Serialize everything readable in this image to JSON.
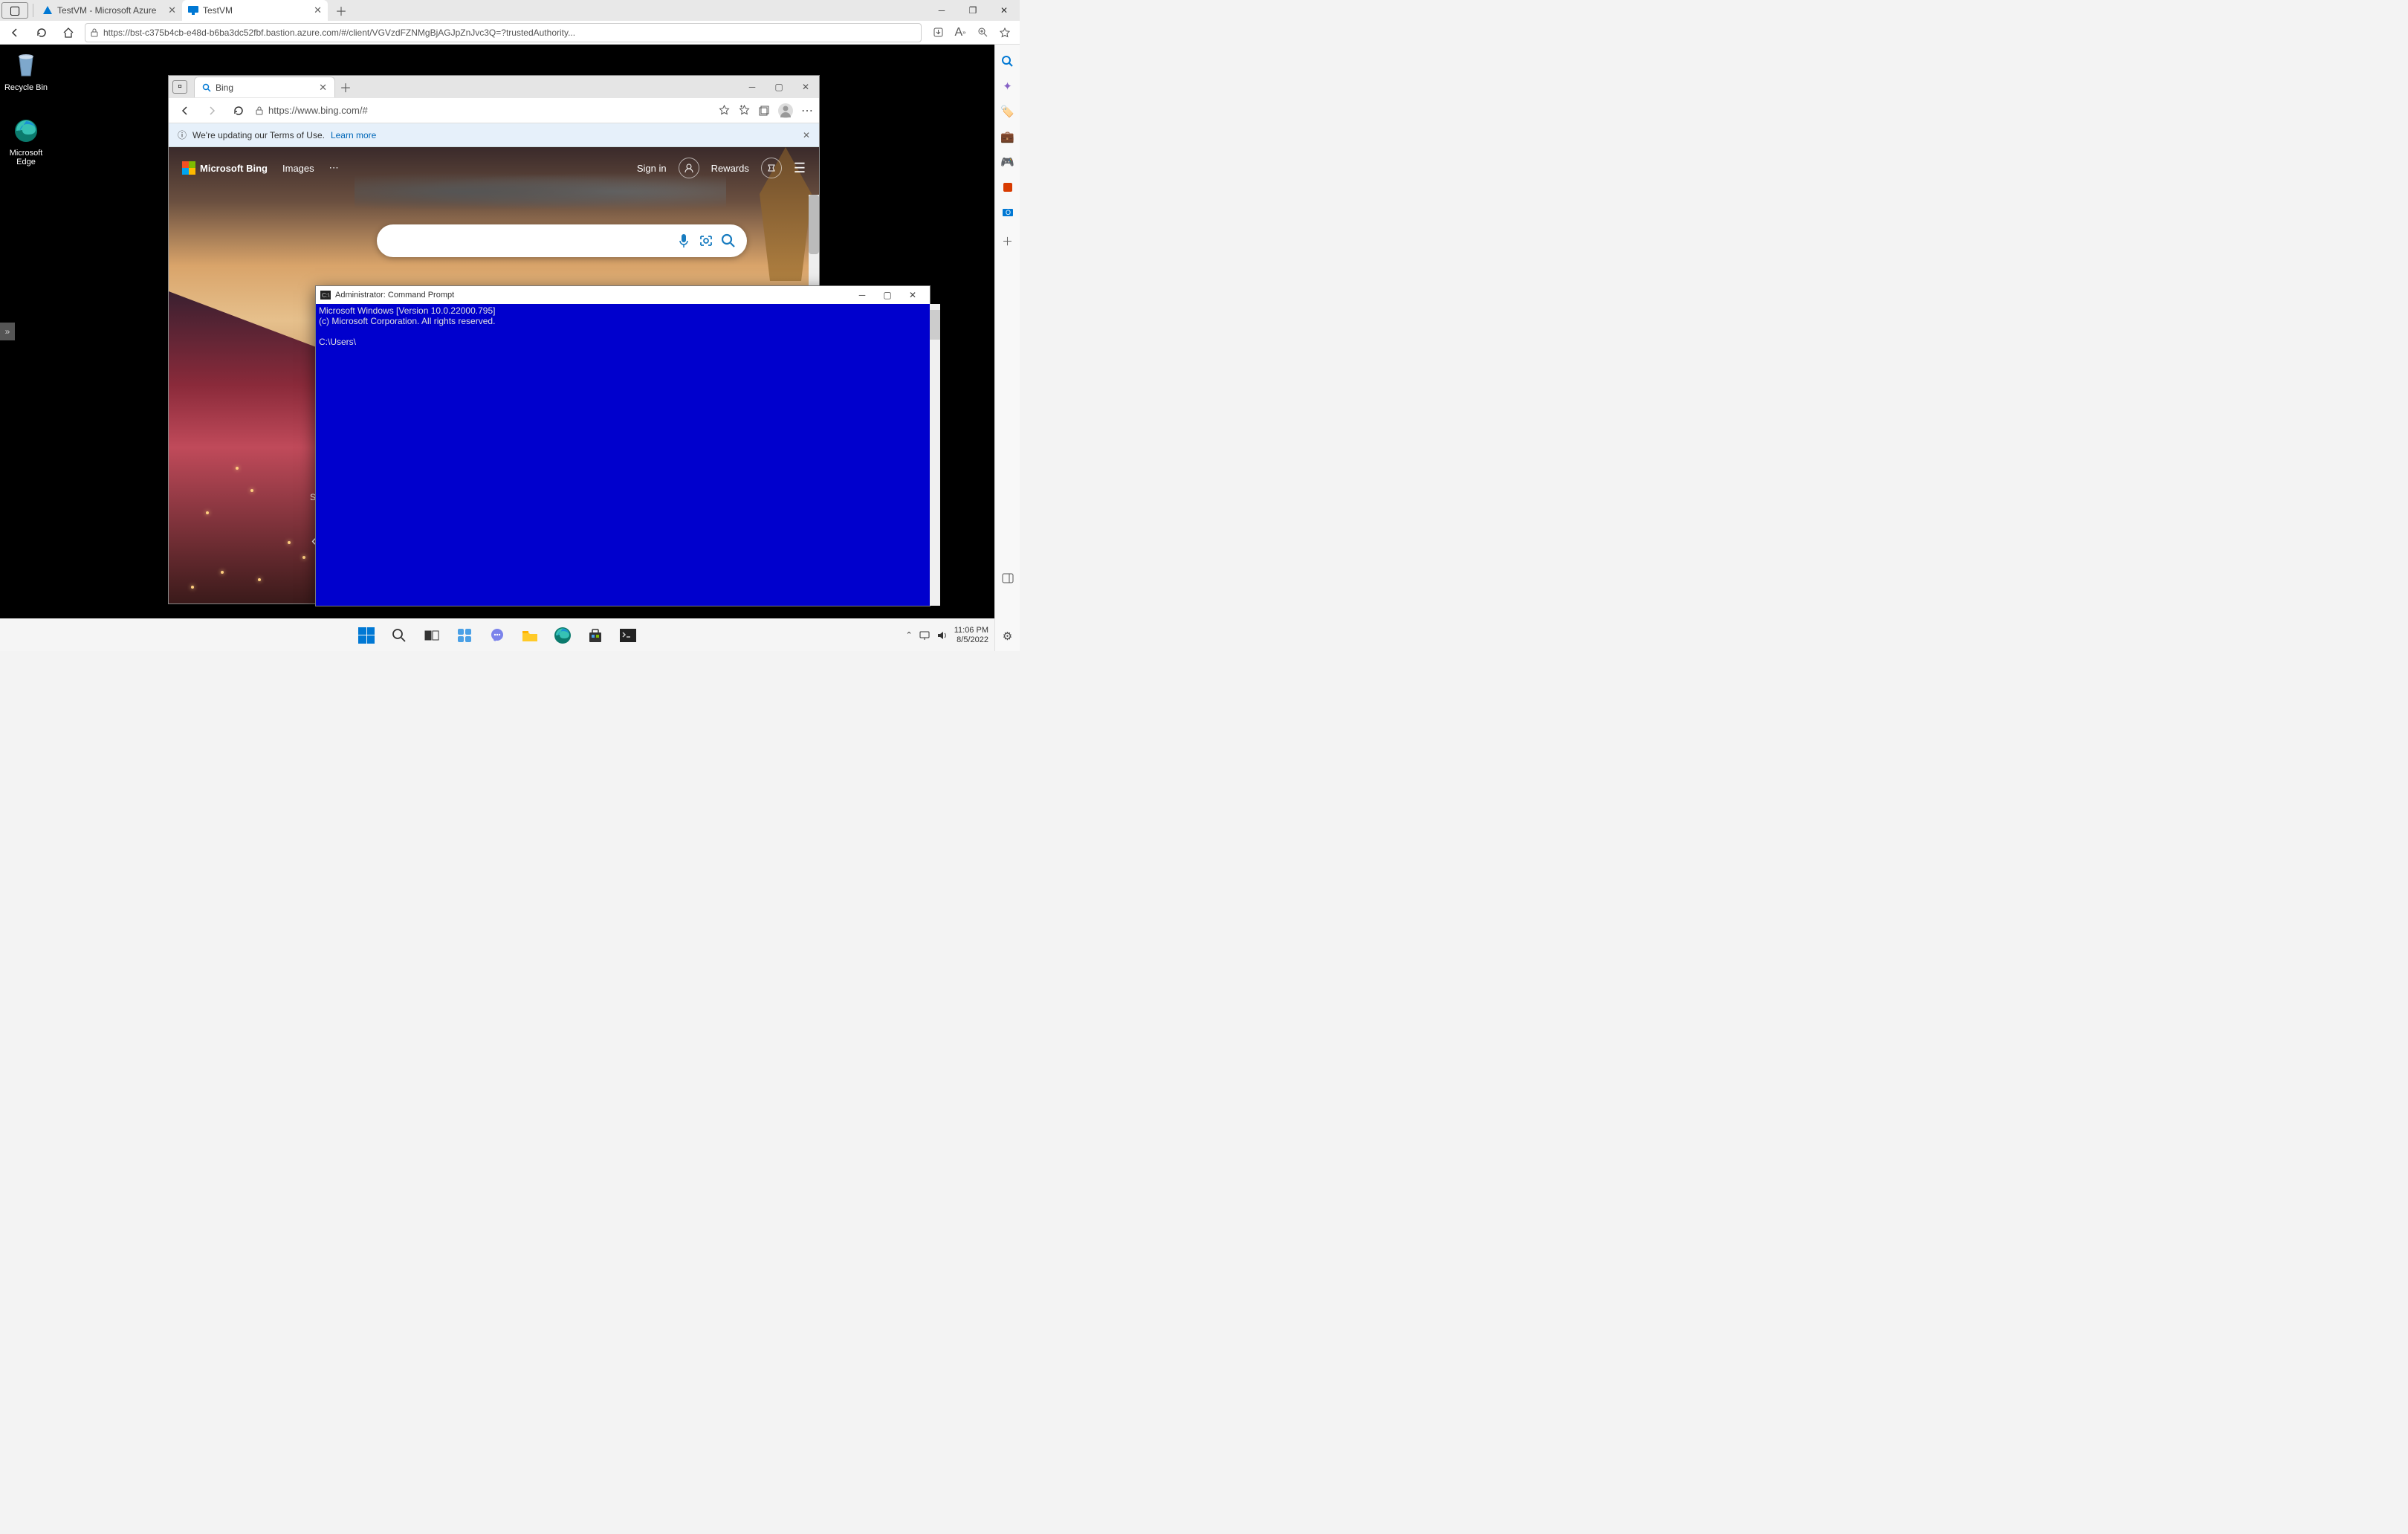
{
  "outer": {
    "tab1": {
      "title": "TestVM  - Microsoft Azure"
    },
    "tab2": {
      "title": "TestVM"
    },
    "url": "https://bst-c375b4cb-e48d-b6ba3dc52fbf.bastion.azure.com/#/client/VGVzdFZNMgBjAGJpZnJvc3Q=?trustedAuthority..."
  },
  "desktop": {
    "recycle": "Recycle Bin",
    "edge": "Microsoft Edge"
  },
  "inner": {
    "tab_title": "Bing",
    "url": "https://www.bing.com/#",
    "notice_text": "We're updating our Terms of Use.",
    "notice_link": "Learn more",
    "logo": "Microsoft Bing",
    "nav_images": "Images",
    "signin": "Sign in",
    "rewards": "Rewards",
    "share_btn": "Sh"
  },
  "cmd": {
    "title": "Administrator: Command Prompt",
    "line1": "Microsoft Windows [Version 10.0.22000.795]",
    "line2": "(c) Microsoft Corporation. All rights reserved.",
    "prompt": "C:\\Users\\"
  },
  "taskbar": {
    "time": "11:06 PM",
    "date": "8/5/2022"
  }
}
